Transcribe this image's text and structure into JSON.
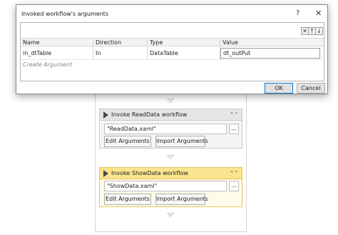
{
  "dialog": {
    "title": "Invoked workflow's arguments",
    "help_glyph": "?",
    "close_glyph": "✕",
    "toolbar": {
      "delete_glyph": "✕",
      "up_glyph": "↑",
      "down_glyph": "↓"
    },
    "columns": [
      "Name",
      "Direction",
      "Type",
      "Value"
    ],
    "rows": [
      {
        "name": "in_dtTable",
        "direction": "In",
        "type": "DataTable",
        "value": "dt_outPut"
      }
    ],
    "create_argument": "Create Argument",
    "ok_label": "OK",
    "cancel_label": "Cancel"
  },
  "activities": [
    {
      "title": "Invoke ReadData workflow",
      "file_path": "\"ReadData.xaml\"",
      "browse_label": "...",
      "edit_label": "Edit Arguments",
      "import_label": "Import Arguments",
      "collapse_glyph": "⌃⌃"
    },
    {
      "title": "Invoke ShowData workflow",
      "file_path": "\"ShowData.xaml\"",
      "browse_label": "...",
      "edit_label": "Edit Arguments",
      "import_label": "Import Arguments",
      "collapse_glyph": "⌃⌃"
    }
  ],
  "colors": {
    "selected_header": "#fbe48f",
    "selected_border": "#e8c35e",
    "ok_border": "#0078d7"
  }
}
